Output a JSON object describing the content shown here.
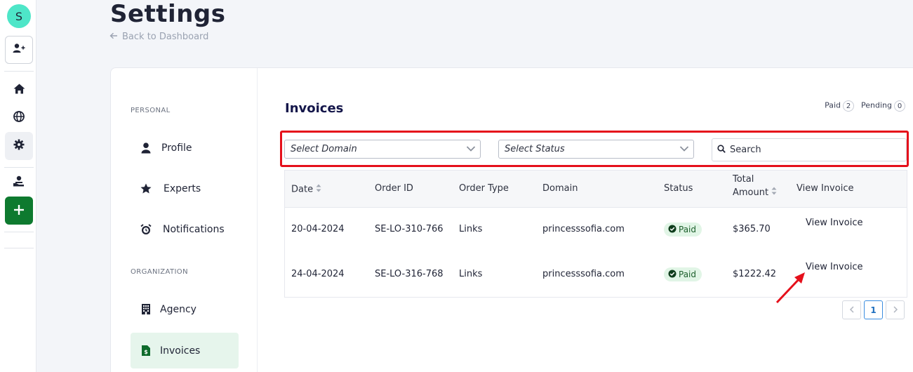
{
  "rail": {
    "avatar_initial": "S",
    "accent_color": "#0e7a2f"
  },
  "header": {
    "title": "Settings",
    "back_label": "Back to Dashboard"
  },
  "sidebar": {
    "personal_label": "PERSONAL",
    "organization_label": "ORGANIZATION",
    "items": [
      {
        "label": "Profile",
        "icon": "user-icon"
      },
      {
        "label": "Experts",
        "icon": "star-icon"
      },
      {
        "label": "Notifications",
        "icon": "alarm-icon"
      },
      {
        "label": "Agency",
        "icon": "building-icon"
      },
      {
        "label": "Invoices",
        "icon": "invoice-icon",
        "selected": true
      }
    ]
  },
  "invoices": {
    "title": "Invoices",
    "paid_label": "Paid",
    "paid_count": "2",
    "pending_label": "Pending",
    "pending_count": "0",
    "filters": {
      "domain_placeholder": "Select Domain",
      "status_placeholder": "Select Status",
      "search_placeholder": "Search"
    },
    "columns": {
      "date": "Date",
      "order_id": "Order ID",
      "order_type": "Order Type",
      "domain": "Domain",
      "status": "Status",
      "total_line1": "Total",
      "total_line2": "Amount",
      "view": "View Invoice"
    },
    "rows": [
      {
        "date": "20-04-2024",
        "order_id": "SE-LO-310-766",
        "order_type": "Links",
        "domain": "princesssofia.com",
        "status": "Paid",
        "amount": "$365.70",
        "view": "View Invoice"
      },
      {
        "date": "24-04-2024",
        "order_id": "SE-LO-316-768",
        "order_type": "Links",
        "domain": "princesssofia.com",
        "status": "Paid",
        "amount": "$1222.42",
        "view": "View Invoice"
      }
    ],
    "pagination": {
      "current_page": "1"
    }
  }
}
